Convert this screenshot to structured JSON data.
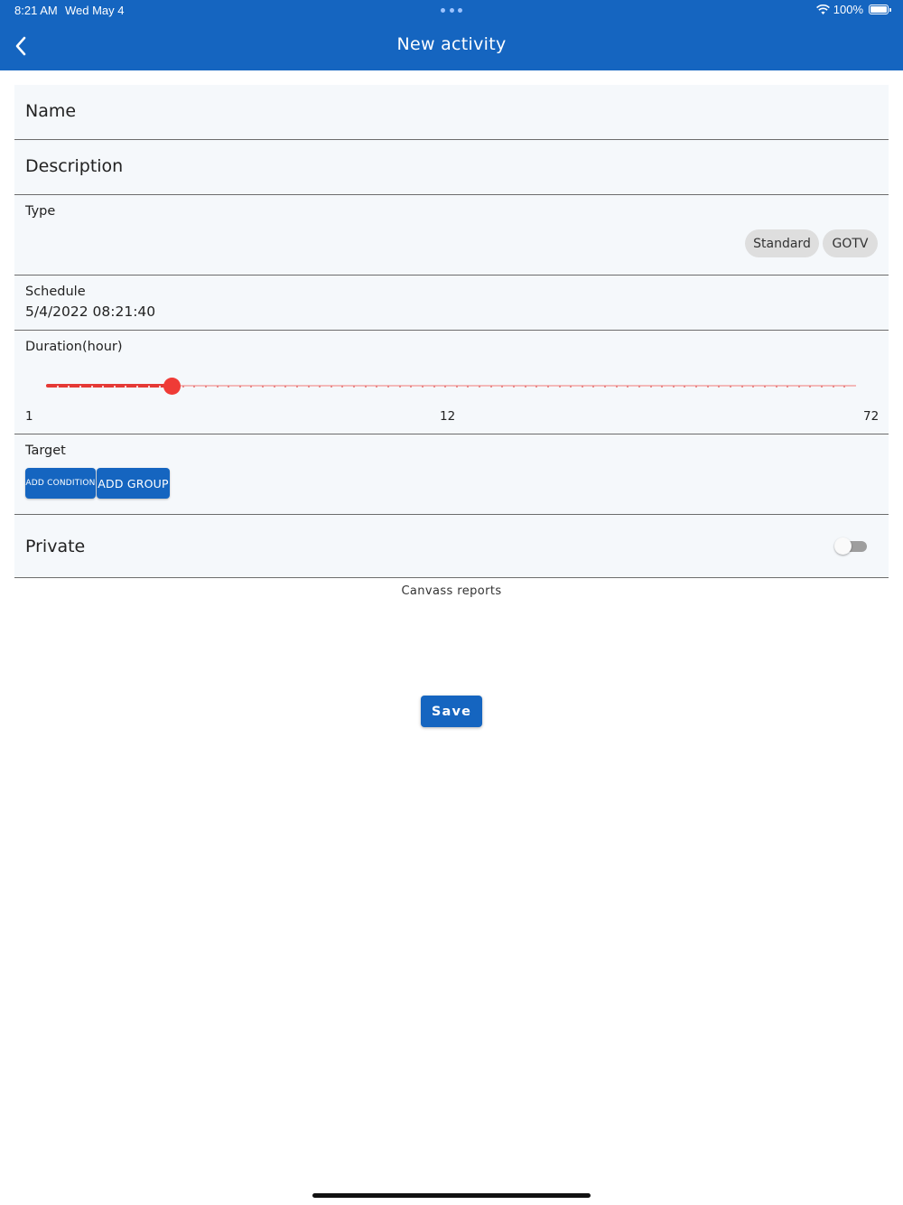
{
  "status_bar": {
    "time": "8:21 AM",
    "date": "Wed May 4",
    "battery": "100%"
  },
  "header": {
    "title": "New activity",
    "back_icon": "chevron-left-icon"
  },
  "form": {
    "name_label": "Name",
    "description_label": "Description",
    "type": {
      "label": "Type",
      "options": [
        "Standard",
        "GOTV"
      ]
    },
    "schedule": {
      "label": "Schedule",
      "value": "5/4/2022 08:21:40"
    },
    "duration": {
      "label": "Duration(hour)",
      "min_label": "1",
      "mid_label": "12",
      "max_label": "72",
      "min": 1,
      "max": 72,
      "value": 12,
      "accent": "#e53935"
    },
    "target": {
      "label": "Target",
      "add_condition": "ADD CONDITION",
      "add_group": "ADD GROUP"
    },
    "private": {
      "label": "Private",
      "enabled": false
    }
  },
  "canvass_reports": "Canvass reports",
  "save_label": "Save",
  "colors": {
    "primary": "#1565c0",
    "field_bg": "#f5f8fb",
    "slider": "#e53935"
  }
}
